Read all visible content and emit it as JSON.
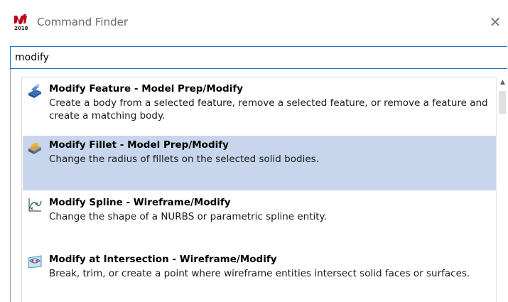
{
  "window": {
    "title": "Command Finder",
    "logo_text": "2018",
    "close_glyph": "✕"
  },
  "search": {
    "value": "modify",
    "placeholder": ""
  },
  "results": [
    {
      "title": "Modify Feature - Model Prep/Modify",
      "description": "Create a body from a selected feature, remove a selected feature, or remove a feature and create a matching body.",
      "icon": "modify-feature-icon",
      "selected": false
    },
    {
      "title": "Modify Fillet - Model Prep/Modify",
      "description": "Change the radius of fillets on the selected solid bodies.",
      "icon": "modify-fillet-icon",
      "selected": true
    },
    {
      "title": "Modify Spline - Wireframe/Modify",
      "description": "Change the shape of a NURBS or parametric spline entity.",
      "icon": "modify-spline-icon",
      "selected": false
    },
    {
      "title": "Modify at Intersection - Wireframe/Modify",
      "description": "Break, trim, or create a point where wireframe entities intersect solid faces or surfaces.",
      "icon": "modify-at-intersection-icon",
      "selected": false
    }
  ],
  "colors": {
    "selection": "#c7d6ec",
    "search_border": "#1e73be",
    "logo_red": "#c0001a"
  }
}
